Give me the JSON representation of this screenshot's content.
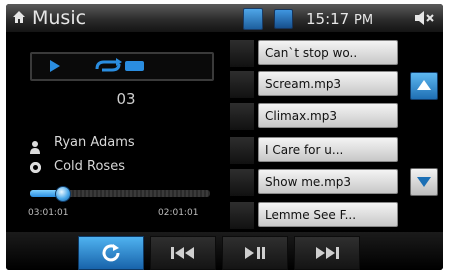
{
  "header": {
    "title": "Music",
    "time": "15:17",
    "ampm": "PM",
    "icons": [
      "home-icon",
      "bluetooth-icon",
      "status-icon",
      "mute-icon"
    ]
  },
  "player": {
    "track_number": "03",
    "artist": "Ryan Adams",
    "album": "Cold Roses",
    "elapsed": "03:01:01",
    "total": "02:01:01",
    "progress_fraction": 0.18
  },
  "playlist": [
    "Can`t stop wo..",
    "Scream.mp3",
    "Climax.mp3",
    "I Care for u...",
    "Show me.mp3",
    "Lemme See F..."
  ],
  "controls": [
    "repeat",
    "previous",
    "play-pause",
    "next"
  ],
  "colors": {
    "accent": "#2a8de0",
    "background": "#000000"
  }
}
